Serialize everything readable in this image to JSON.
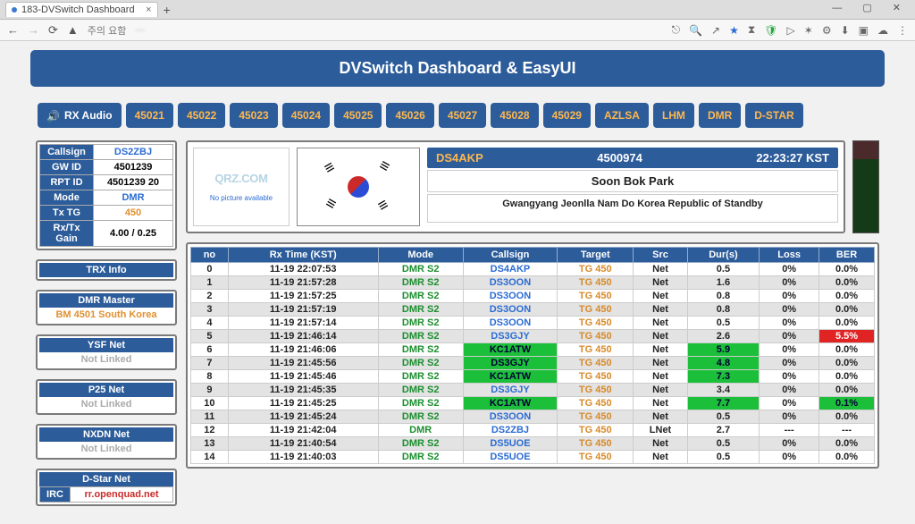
{
  "browser": {
    "tab_title": "183-DVSwitch Dashboard",
    "url_warning": "주의 요함",
    "url_blurred": "···"
  },
  "banner": "DVSwitch Dashboard & EasyUI",
  "nav": {
    "rx_audio": "RX Audio",
    "items": [
      "45021",
      "45022",
      "45023",
      "45024",
      "45025",
      "45026",
      "45027",
      "45028",
      "45029",
      "AZLSA",
      "LHM",
      "DMR",
      "D-STAR"
    ]
  },
  "station": {
    "rows": {
      "callsign_k": "Callsign",
      "callsign_v": "DS2ZBJ",
      "gwid_k": "GW ID",
      "gwid_v": "4501239",
      "rptid_k": "RPT ID",
      "rptid_v": "4501239 20",
      "mode_k": "Mode",
      "mode_v": "DMR",
      "txtg_k": "Tx TG",
      "txtg_v": "450",
      "gain_k": "Rx/Tx Gain",
      "gain_v": "4.00 / 0.25"
    }
  },
  "trx_info": "TRX Info",
  "dmr_master": {
    "head": "DMR Master",
    "value": "BM 4501 South Korea"
  },
  "ysf": {
    "head": "YSF Net",
    "value": "Not Linked"
  },
  "p25": {
    "head": "P25 Net",
    "value": "Not Linked"
  },
  "nxdn": {
    "head": "NXDN Net",
    "value": "Not Linked"
  },
  "dstar": {
    "head": "D-Star Net",
    "irc_k": "IRC",
    "irc_v": "rr.openquad.net"
  },
  "current": {
    "callsign": "DS4AKP",
    "id": "4500974",
    "time": "22:23:27 KST",
    "name": "Soon Bok Park",
    "location": "Gwangyang Jeonlla Nam Do Korea Republic of Standby",
    "qrz_label": "QRZ.COM",
    "noimg": "No picture available"
  },
  "log": {
    "headers": [
      "no",
      "Rx Time (KST)",
      "Mode",
      "Callsign",
      "Target",
      "Src",
      "Dur(s)",
      "Loss",
      "BER"
    ],
    "rows": [
      {
        "no": "0",
        "time": "11-19 22:07:53",
        "mode": "DMR S2",
        "call": "DS4AKP",
        "call_fmt": "blue",
        "target": "TG 450",
        "src": "Net",
        "dur": "0.5",
        "loss": "0%",
        "ber": "0.0%"
      },
      {
        "no": "1",
        "time": "11-19 21:57:28",
        "mode": "DMR S2",
        "call": "DS3OON",
        "call_fmt": "blue",
        "target": "TG 450",
        "src": "Net",
        "dur": "1.6",
        "loss": "0%",
        "ber": "0.0%"
      },
      {
        "no": "2",
        "time": "11-19 21:57:25",
        "mode": "DMR S2",
        "call": "DS3OON",
        "call_fmt": "blue",
        "target": "TG 450",
        "src": "Net",
        "dur": "0.8",
        "loss": "0%",
        "ber": "0.0%"
      },
      {
        "no": "3",
        "time": "11-19 21:57:19",
        "mode": "DMR S2",
        "call": "DS3OON",
        "call_fmt": "blue",
        "target": "TG 450",
        "src": "Net",
        "dur": "0.8",
        "loss": "0%",
        "ber": "0.0%"
      },
      {
        "no": "4",
        "time": "11-19 21:57:14",
        "mode": "DMR S2",
        "call": "DS3OON",
        "call_fmt": "blue",
        "target": "TG 450",
        "src": "Net",
        "dur": "0.5",
        "loss": "0%",
        "ber": "0.0%"
      },
      {
        "no": "5",
        "time": "11-19 21:46:14",
        "mode": "DMR S2",
        "call": "DS3GJY",
        "call_fmt": "blue",
        "target": "TG 450",
        "src": "Net",
        "dur": "2.6",
        "loss": "0%",
        "ber": "5.5%",
        "ber_fmt": "red"
      },
      {
        "no": "6",
        "time": "11-19 21:46:06",
        "mode": "DMR S2",
        "call": "KC1ATW",
        "call_fmt": "greenbg",
        "target": "TG 450",
        "src": "Net",
        "dur": "5.9",
        "dur_fmt": "greenbg",
        "loss": "0%",
        "ber": "0.0%"
      },
      {
        "no": "7",
        "time": "11-19 21:45:56",
        "mode": "DMR S2",
        "call": "DS3GJY",
        "call_fmt": "greenbg",
        "target": "TG 450",
        "src": "Net",
        "dur": "4.8",
        "dur_fmt": "greenbg",
        "loss": "0%",
        "ber": "0.0%"
      },
      {
        "no": "8",
        "time": "11-19 21:45:46",
        "mode": "DMR S2",
        "call": "KC1ATW",
        "call_fmt": "greenbg",
        "target": "TG 450",
        "src": "Net",
        "dur": "7.3",
        "dur_fmt": "greenbg",
        "loss": "0%",
        "ber": "0.0%"
      },
      {
        "no": "9",
        "time": "11-19 21:45:35",
        "mode": "DMR S2",
        "call": "DS3GJY",
        "call_fmt": "blue",
        "target": "TG 450",
        "src": "Net",
        "dur": "3.4",
        "loss": "0%",
        "ber": "0.0%"
      },
      {
        "no": "10",
        "time": "11-19 21:45:25",
        "mode": "DMR S2",
        "call": "KC1ATW",
        "call_fmt": "greenbg",
        "target": "TG 450",
        "src": "Net",
        "dur": "7.7",
        "dur_fmt": "greenbg",
        "loss": "0%",
        "ber": "0.1%",
        "ber_fmt": "greenbg"
      },
      {
        "no": "11",
        "time": "11-19 21:45:24",
        "mode": "DMR S2",
        "call": "DS3OON",
        "call_fmt": "blue",
        "target": "TG 450",
        "src": "Net",
        "dur": "0.5",
        "loss": "0%",
        "ber": "0.0%"
      },
      {
        "no": "12",
        "time": "11-19 21:42:04",
        "mode": "DMR",
        "call": "DS2ZBJ",
        "call_fmt": "blue",
        "target": "TG 450",
        "src": "LNet",
        "dur": "2.7",
        "loss": "---",
        "ber": "---"
      },
      {
        "no": "13",
        "time": "11-19 21:40:54",
        "mode": "DMR S2",
        "call": "DS5UOE",
        "call_fmt": "blue",
        "target": "TG 450",
        "src": "Net",
        "dur": "0.5",
        "loss": "0%",
        "ber": "0.0%"
      },
      {
        "no": "14",
        "time": "11-19 21:40:03",
        "mode": "DMR S2",
        "call": "DS5UOE",
        "call_fmt": "blue",
        "target": "TG 450",
        "src": "Net",
        "dur": "0.5",
        "loss": "0%",
        "ber": "0.0%"
      }
    ]
  }
}
